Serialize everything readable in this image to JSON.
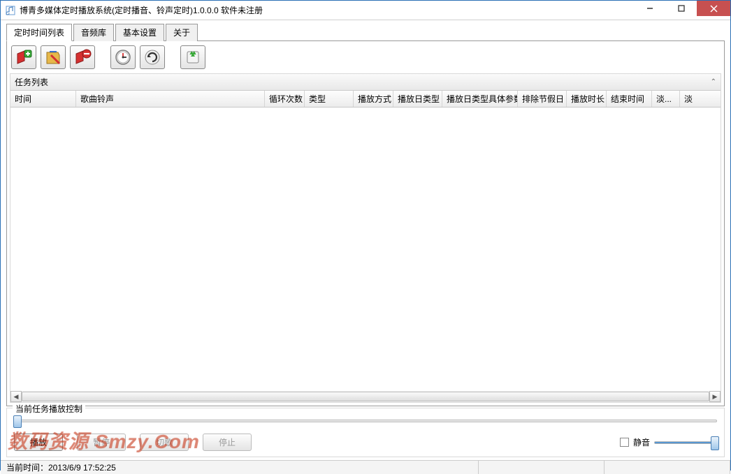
{
  "window": {
    "title": "博青多媒体定时播放系统(定时播音、铃声定时)1.0.0.0 软件未注册"
  },
  "tabs": {
    "t0": "定时时间列表",
    "t1": "音频库",
    "t2": "基本设置",
    "t3": "关于"
  },
  "task_panel": {
    "title": "任务列表"
  },
  "columns": {
    "c0": "时间",
    "c1": "歌曲铃声",
    "c2": "循环次数",
    "c3": "类型",
    "c4": "播放方式",
    "c5": "播放日类型",
    "c6": "播放日类型具体参数",
    "c7": "排除节假日",
    "c8": "播放时长",
    "c9": "结束时间",
    "c10": "淡...",
    "c11": "淡"
  },
  "column_widths": {
    "c0": 94,
    "c1": 270,
    "c2": 57,
    "c3": 70,
    "c4": 57,
    "c5": 70,
    "c6": 108,
    "c7": 70,
    "c8": 57,
    "c9": 65,
    "c10": 40,
    "c11": 24
  },
  "playback": {
    "legend": "当前任务播放控制",
    "play": "播放",
    "pause": "暂停",
    "next": "切歌",
    "stop": "停止",
    "mute": "静音"
  },
  "status": {
    "time_label": "当前时间：2013/6/9 17:52:25"
  },
  "watermark": "数码资源 Smzy.Com",
  "icons": {
    "add": "add-icon",
    "edit": "edit-icon",
    "delete": "delete-icon",
    "clock": "clock-icon",
    "refresh": "refresh-icon",
    "recycle": "recycle-icon"
  }
}
